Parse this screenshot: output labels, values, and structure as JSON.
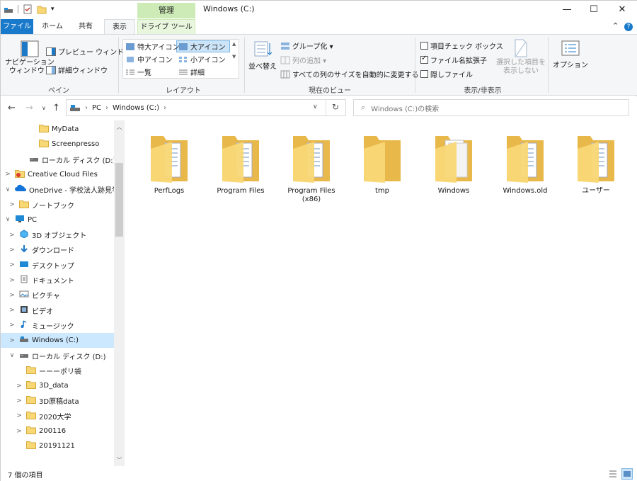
{
  "titlebar": {
    "title": "Windows (C:)",
    "context_tab": "管理",
    "minimize": "—",
    "maximize": "☐",
    "close": "✕"
  },
  "tabs": [
    {
      "label": "ファイル"
    },
    {
      "label": "ホーム"
    },
    {
      "label": "共有"
    },
    {
      "label": "表示"
    },
    {
      "label": "ドライブ ツール"
    }
  ],
  "ribbon": {
    "pane": {
      "nav_pane": "ナビゲーション\nウィンドウ ▾",
      "preview": "プレビュー ウィンドウ",
      "details": "詳細ウィンドウ",
      "group": "ペイン"
    },
    "layout": {
      "items": [
        "特大アイコン",
        "大アイコン",
        "中アイコン",
        "小アイコン",
        "一覧",
        "詳細"
      ],
      "group": "レイアウト"
    },
    "current_view": {
      "sort": "並べ替え",
      "group_by": "グループ化 ▾",
      "add_column": "列の追加 ▾",
      "fit_columns": "すべての列のサイズを自動的に変更する",
      "group": "現在のビュー"
    },
    "show_hide": {
      "item_checkboxes": "項目チェック ボックス",
      "file_extensions": "ファイル名拡張子",
      "hidden_items": "隠しファイル",
      "hide_selected": "選択した項目を\n表示しない",
      "group": "表示/非表示"
    },
    "options": "オプション"
  },
  "address": {
    "crumbs": [
      "PC",
      "Windows (C:)"
    ],
    "search_placeholder": "Windows (C:)の検索"
  },
  "tree": [
    {
      "label": "MyData",
      "expander": "",
      "icon": "folder-icon"
    },
    {
      "label": "Screenpresso",
      "expander": "",
      "icon": "folder-icon"
    },
    {
      "label": "ローカル ディスク (D:)",
      "expander": "",
      "icon": "drive-icon"
    },
    {
      "label": "Creative Cloud Files",
      "expander": ">",
      "icon": "creative-cloud-icon"
    },
    {
      "label": "OneDrive - 学校法人跡見学",
      "expander": "∨",
      "icon": "onedrive-icon"
    },
    {
      "label": "ノートブック",
      "expander": ">",
      "icon": "folder-icon"
    },
    {
      "label": "PC",
      "expander": "∨",
      "icon": "pc-icon"
    },
    {
      "label": "3D オブジェクト",
      "expander": ">",
      "icon": "3d-objects-icon"
    },
    {
      "label": "ダウンロード",
      "expander": ">",
      "icon": "download-icon"
    },
    {
      "label": "デスクトップ",
      "expander": ">",
      "icon": "desktop-icon"
    },
    {
      "label": "ドキュメント",
      "expander": ">",
      "icon": "documents-icon"
    },
    {
      "label": "ピクチャ",
      "expander": ">",
      "icon": "pictures-icon"
    },
    {
      "label": "ビデオ",
      "expander": ">",
      "icon": "videos-icon"
    },
    {
      "label": "ミュージック",
      "expander": ">",
      "icon": "music-icon"
    },
    {
      "label": "Windows (C:)",
      "expander": ">",
      "icon": "windows-drive-icon"
    },
    {
      "label": "ローカル ディスク (D:)",
      "expander": "∨",
      "icon": "drive-icon"
    },
    {
      "label": "ーーーポリ袋",
      "expander": "",
      "icon": "folder-icon"
    },
    {
      "label": "3D_data",
      "expander": ">",
      "icon": "folder-icon"
    },
    {
      "label": "3D原稿data",
      "expander": ">",
      "icon": "folder-icon"
    },
    {
      "label": "2020大学",
      "expander": ">",
      "icon": "folder-icon"
    },
    {
      "label": "200116",
      "expander": ">",
      "icon": "folder-icon"
    },
    {
      "label": "20191121",
      "expander": "",
      "icon": "folder-icon"
    }
  ],
  "items": [
    {
      "name": "PerfLogs",
      "icon": "folder-with-documents-icon"
    },
    {
      "name": "Program Files",
      "icon": "folder-with-documents-icon"
    },
    {
      "name": "Program Files\n(x86)",
      "icon": "folder-with-documents-icon"
    },
    {
      "name": "tmp",
      "icon": "folder-icon"
    },
    {
      "name": "Windows",
      "icon": "folder-with-white-documents-icon"
    },
    {
      "name": "Windows.old",
      "icon": "folder-with-documents-icon"
    },
    {
      "name": "ユーザー",
      "icon": "folder-with-documents-icon"
    }
  ],
  "status": {
    "count": "7 個の項目"
  },
  "colors": {
    "accent": "#1979ca",
    "selection": "#cce8ff",
    "context_tab": "#cdebb6",
    "folder": "#f8d775",
    "folder_dark": "#e8b84a"
  }
}
